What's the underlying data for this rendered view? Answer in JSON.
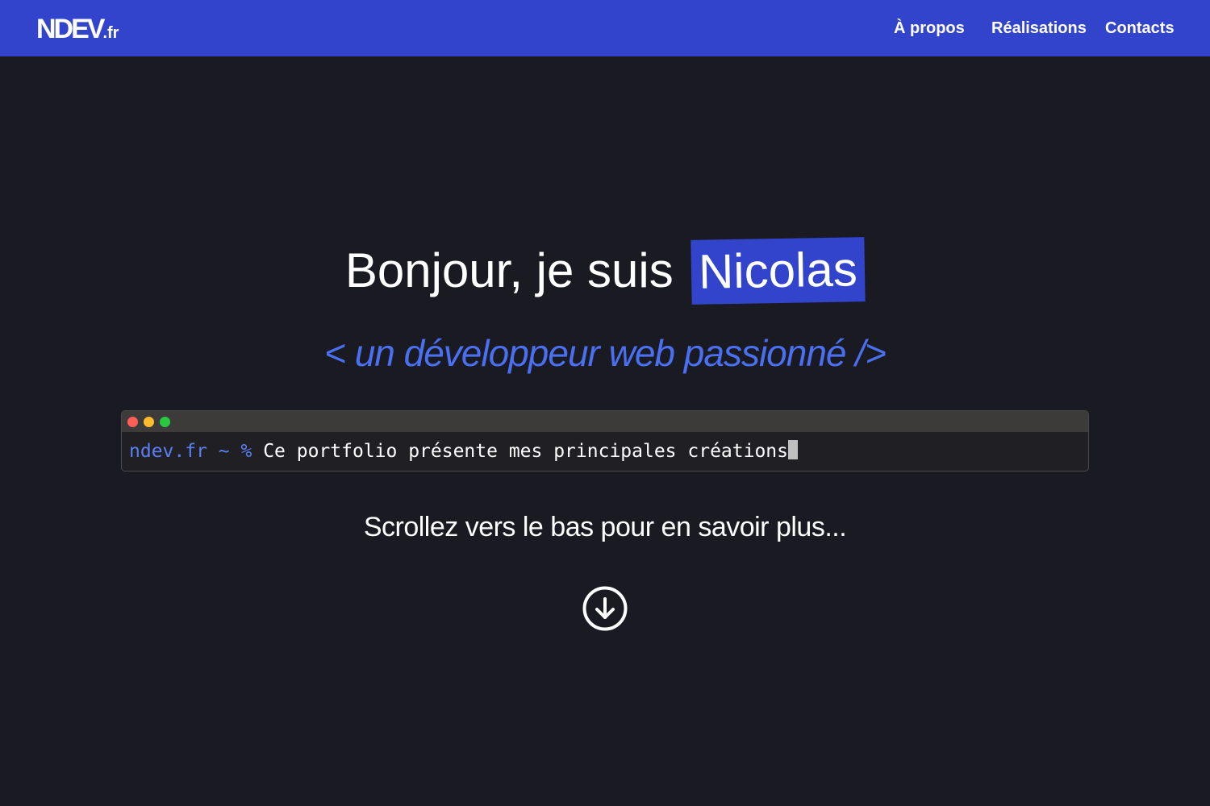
{
  "navbar": {
    "logo_main": "NDEV",
    "logo_tld": ".fr",
    "links": [
      {
        "label": "À propos"
      },
      {
        "label": "Réalisations"
      },
      {
        "label": "Contacts"
      }
    ]
  },
  "hero": {
    "greeting": "Bonjour, je suis",
    "name": "Nicolas",
    "subtitle": "< un développeur web passionné />"
  },
  "terminal": {
    "prompt": "ndev.fr ~ %",
    "command": "Ce portfolio présente mes principales créations"
  },
  "scroll": {
    "hint": "Scrollez vers le bas pour en savoir plus...",
    "icon": "arrow-down-circle-icon"
  },
  "colors": {
    "navbar_bg": "#3344cc",
    "page_bg": "#1a1a22",
    "accent_text": "#4a6ff0",
    "terminal_bar": "#3d3b3a"
  }
}
